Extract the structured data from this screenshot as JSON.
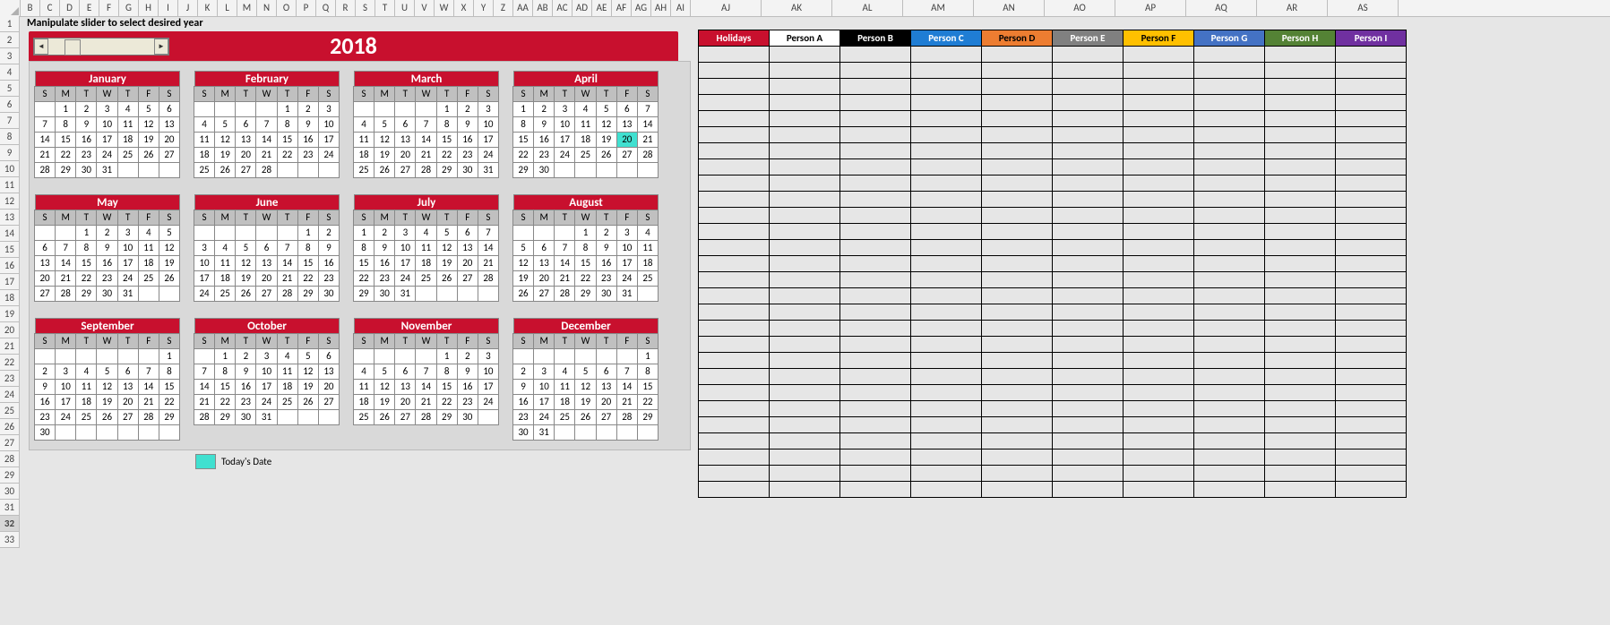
{
  "instruction": "Manipulate slider to select desired year",
  "year": "2018",
  "legend_label": "Today's Date",
  "today": {
    "month": 3,
    "day": 20
  },
  "daysOfWeek": [
    "S",
    "M",
    "T",
    "W",
    "T",
    "F",
    "S"
  ],
  "col_letters_narrow": [
    "B",
    "C",
    "D",
    "E",
    "F",
    "G",
    "H",
    "I",
    "J",
    "K",
    "L",
    "M",
    "N",
    "O",
    "P",
    "Q",
    "R",
    "S",
    "T",
    "U",
    "V",
    "W",
    "X",
    "Y",
    "Z",
    "AA",
    "AB",
    "AC",
    "AD",
    "AE",
    "AF",
    "AG",
    "AH",
    "AI"
  ],
  "col_letters_wide": [
    "AJ",
    "AK",
    "AL",
    "AM",
    "AN",
    "AO",
    "AP",
    "AQ",
    "AR",
    "AS"
  ],
  "row_numbers": [
    "1",
    "2",
    "3",
    "4",
    "5",
    "6",
    "7",
    "8",
    "9",
    "10",
    "11",
    "12",
    "13",
    "14",
    "15",
    "16",
    "17",
    "18",
    "19",
    "20",
    "21",
    "22",
    "23",
    "24",
    "25",
    "26",
    "27",
    "28",
    "29",
    "30",
    "31",
    "32",
    "33"
  ],
  "selected_row": "32",
  "months": [
    {
      "name": "January",
      "first": 1,
      "count": 31
    },
    {
      "name": "February",
      "first": 4,
      "count": 28
    },
    {
      "name": "March",
      "first": 4,
      "count": 31
    },
    {
      "name": "April",
      "first": 0,
      "count": 30
    },
    {
      "name": "May",
      "first": 2,
      "count": 31
    },
    {
      "name": "June",
      "first": 5,
      "count": 30
    },
    {
      "name": "July",
      "first": 0,
      "count": 31
    },
    {
      "name": "August",
      "first": 3,
      "count": 31
    },
    {
      "name": "September",
      "first": 6,
      "count": 30
    },
    {
      "name": "October",
      "first": 1,
      "count": 31
    },
    {
      "name": "November",
      "first": 4,
      "count": 30
    },
    {
      "name": "December",
      "first": 6,
      "count": 31
    }
  ],
  "person_headers": [
    {
      "label": "Holidays",
      "bg": "#c8102e",
      "fg": "#fff"
    },
    {
      "label": "Person A",
      "bg": "#ffffff",
      "fg": "#000"
    },
    {
      "label": "Person B",
      "bg": "#000000",
      "fg": "#fff"
    },
    {
      "label": "Person C",
      "bg": "#1f7dd4",
      "fg": "#fff"
    },
    {
      "label": "Person D",
      "bg": "#ed7d31",
      "fg": "#000"
    },
    {
      "label": "Person E",
      "bg": "#808080",
      "fg": "#fff"
    },
    {
      "label": "Person F",
      "bg": "#ffc000",
      "fg": "#000"
    },
    {
      "label": "Person G",
      "bg": "#4472c4",
      "fg": "#fff"
    },
    {
      "label": "Person H",
      "bg": "#548235",
      "fg": "#fff"
    },
    {
      "label": "Person I",
      "bg": "#7030a0",
      "fg": "#fff"
    }
  ],
  "person_rows": 28
}
